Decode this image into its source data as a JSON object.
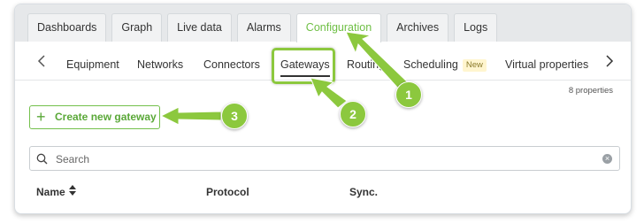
{
  "main_tabs": [
    {
      "label": "Dashboards",
      "active": false
    },
    {
      "label": "Graph",
      "active": false
    },
    {
      "label": "Live data",
      "active": false
    },
    {
      "label": "Alarms",
      "active": false
    },
    {
      "label": "Configuration",
      "active": true
    },
    {
      "label": "Archives",
      "active": false
    },
    {
      "label": "Logs",
      "active": false
    }
  ],
  "sub_nav": {
    "items": [
      {
        "label": "Equipment"
      },
      {
        "label": "Networks"
      },
      {
        "label": "Connectors"
      },
      {
        "label": "Gateways",
        "active": true
      },
      {
        "label": "Routing"
      },
      {
        "label": "Scheduling",
        "badge": "New"
      },
      {
        "label": "Virtual properties"
      }
    ],
    "prev_icon": "chevron-left-icon",
    "next_icon": "chevron-right-icon"
  },
  "properties_count": "8 properties",
  "create_button": {
    "label": "Create new gateway",
    "icon": "plus-icon"
  },
  "search": {
    "placeholder": "Search",
    "icon": "search-icon",
    "clear_icon": "clear-icon"
  },
  "table": {
    "columns": [
      {
        "label": "Name",
        "sortable": true
      },
      {
        "label": "Protocol"
      },
      {
        "label": "Sync."
      }
    ]
  },
  "annotations": {
    "color": "#8cc83e",
    "step1": "1",
    "step2": "2",
    "step3": "3"
  },
  "colors": {
    "accent": "#6fbf45",
    "annotation": "#8cc83e"
  }
}
